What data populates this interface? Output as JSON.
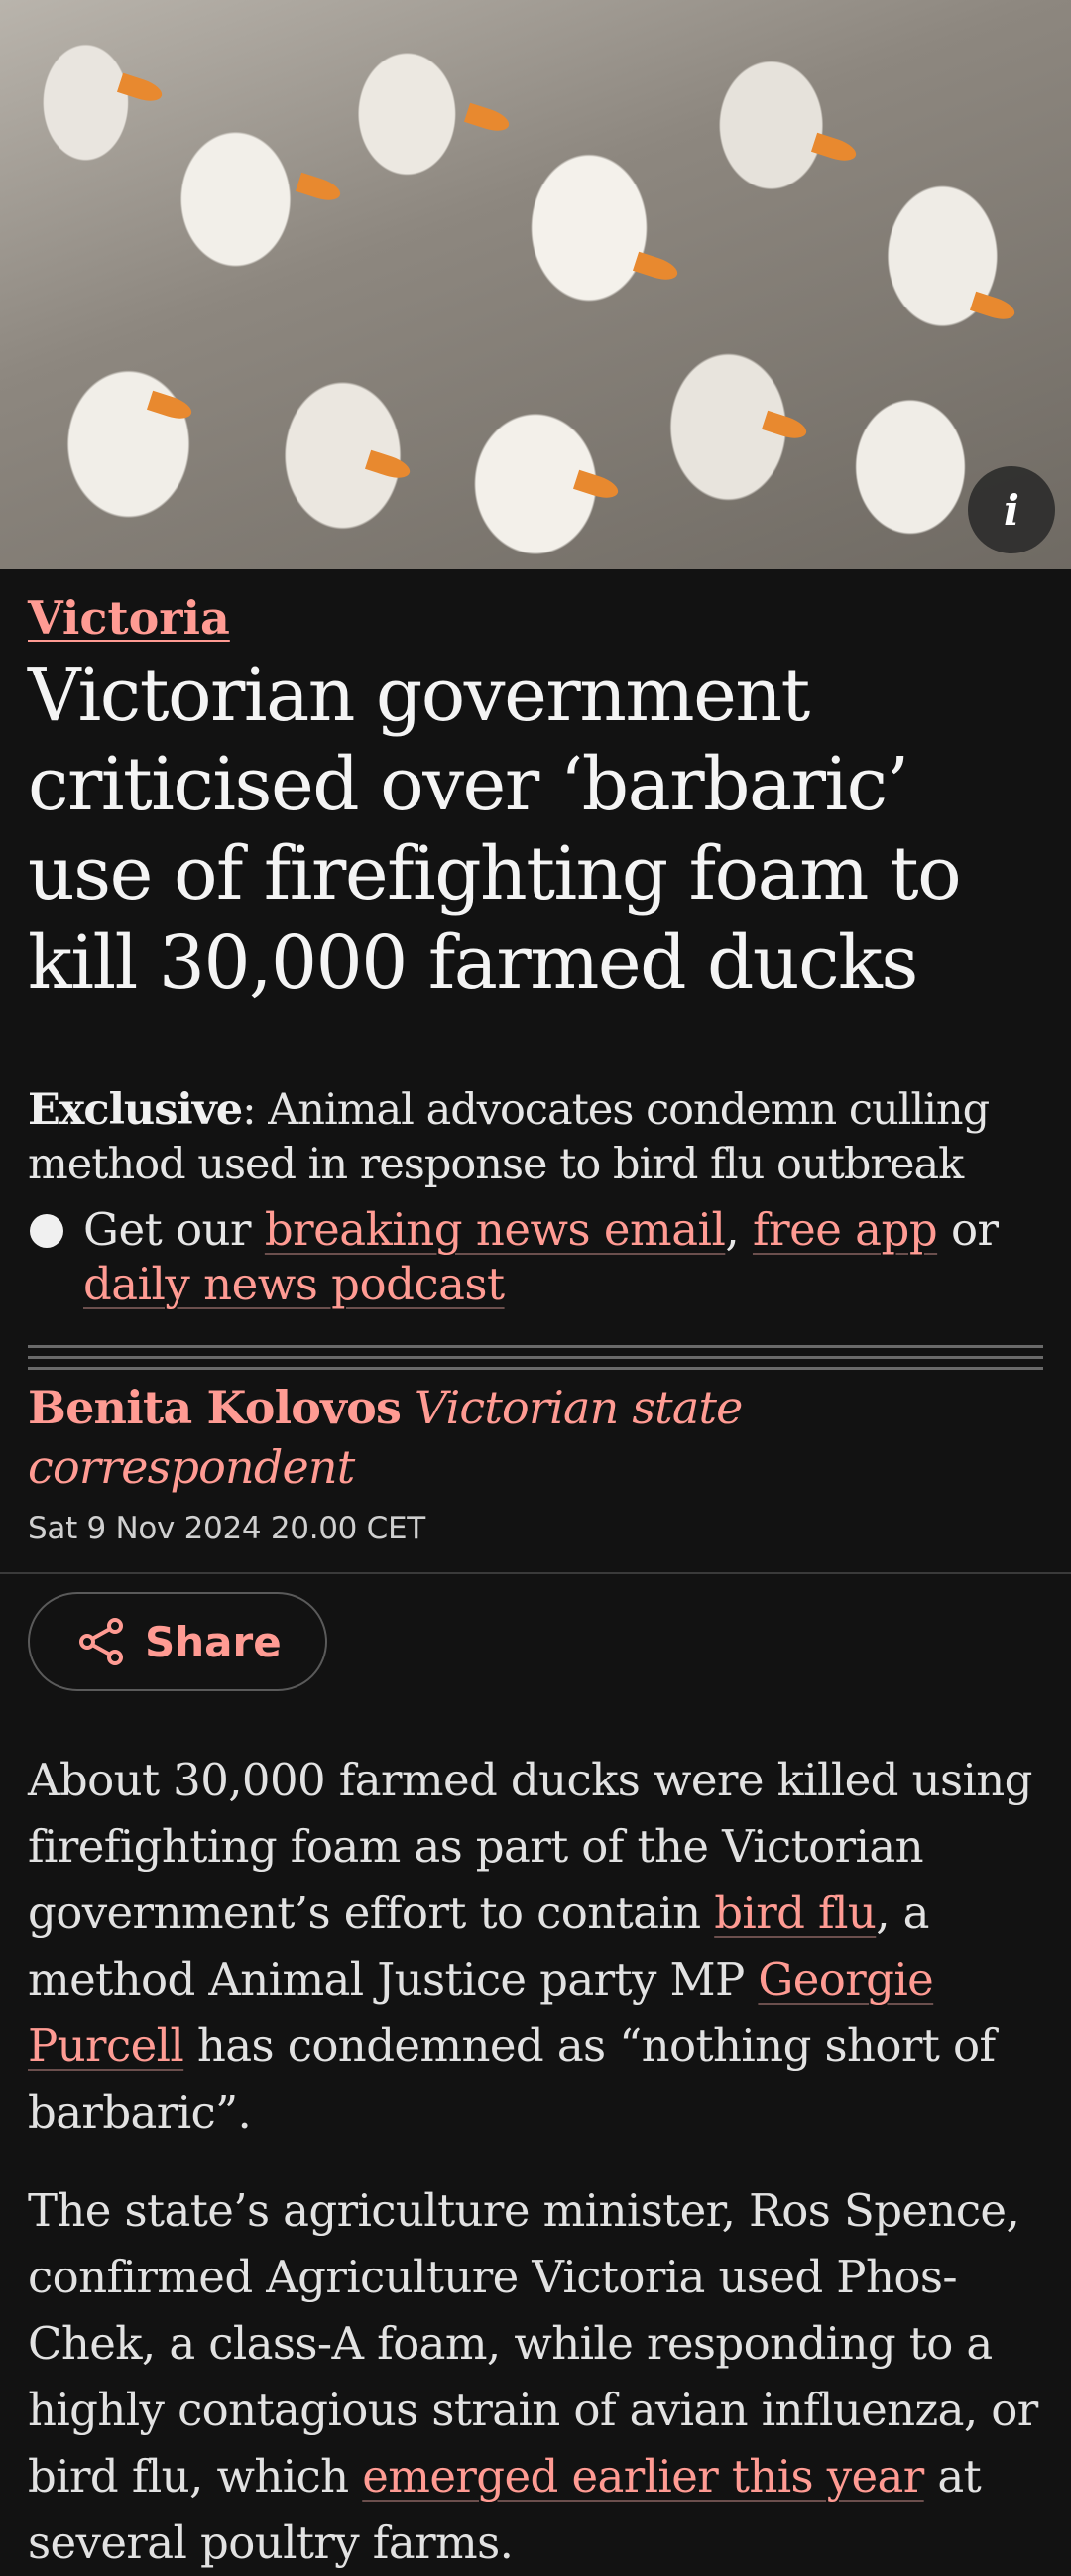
{
  "hero": {
    "info_icon_glyph": "i"
  },
  "article": {
    "kicker": "Victoria",
    "headline": "Victorian government criticised over ‘barbaric’ use of firefighting foam to kill 30,000 farmed ducks",
    "standfirst_bold": "Exclusive",
    "standfirst_rest": ": Animal advocates condemn culling method used in response to bird flu outbreak",
    "promo": {
      "prefix": "Get our ",
      "link1": "breaking news email",
      "sep": ", ",
      "link2": "free app",
      "mid": " or ",
      "link3": "daily news podcast"
    },
    "byline_author": "Benita Kolovos",
    "byline_role": "Victorian state correspondent",
    "dateline": "Sat 9 Nov 2024 20.00 CET",
    "share_label": "Share",
    "para1": {
      "t1": "About 30,000 farmed ducks were killed using firefighting foam as part of the Victorian government’s effort to contain ",
      "link1": "bird flu",
      "t2": ", a method Animal Justice party MP ",
      "link2": "Georgie Purcell",
      "t3": " has condemned as “nothing short of barbaric”."
    },
    "para2": {
      "t1": "The state’s agriculture minister, Ros Spence, confirmed Agriculture Victoria used Phos-Chek, a class-A foam, while responding to a highly contagious strain of avian influenza, or bird flu, which ",
      "link1": "emerged earlier this year",
      "t2": " at several poultry farms."
    }
  },
  "colors": {
    "background": "#121212",
    "accent": "#ff9b93",
    "text": "#dcdcdc"
  }
}
